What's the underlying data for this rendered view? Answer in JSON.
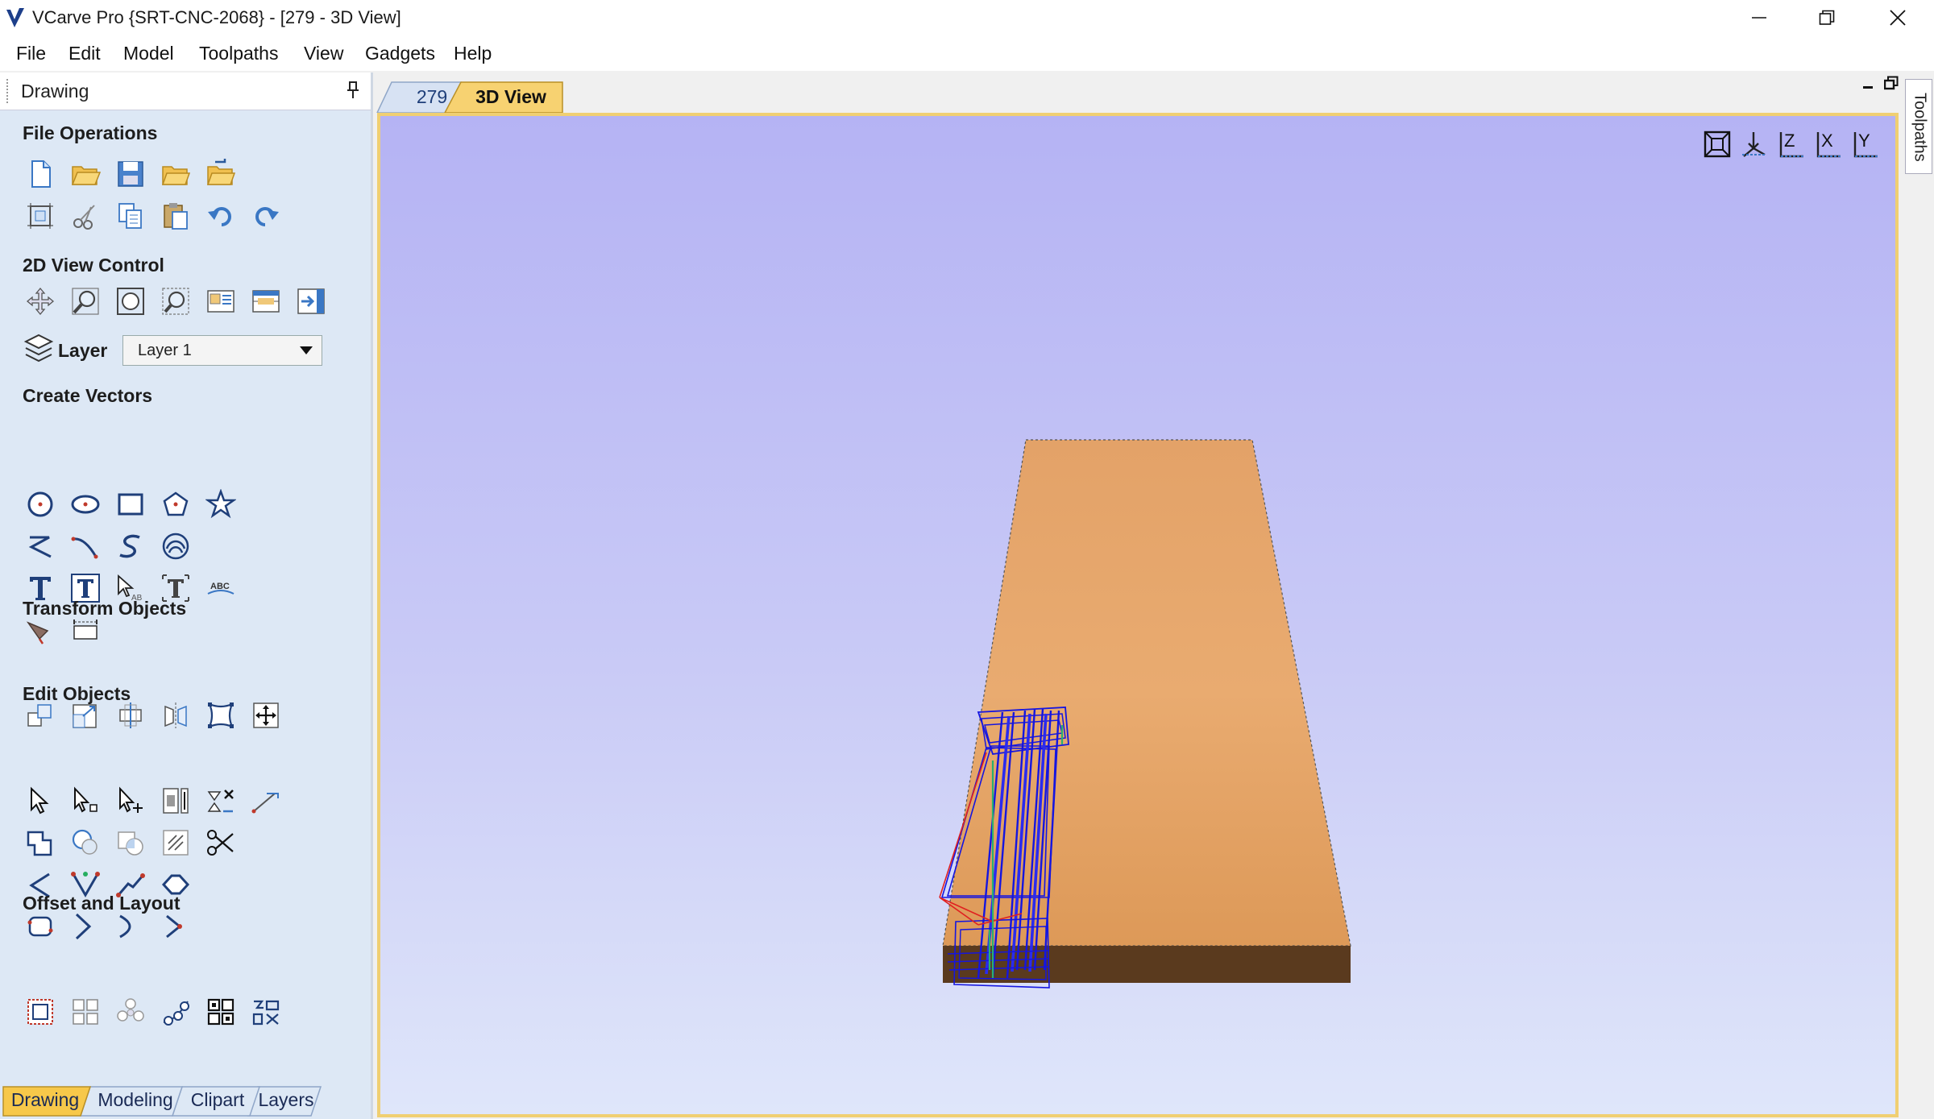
{
  "window": {
    "title": "VCarve Pro {SRT-CNC-2068} - [279 - 3D View]",
    "icons": {
      "minimize": "minimize-icon",
      "restore": "restore-icon",
      "close": "close-icon"
    }
  },
  "menu": {
    "items": [
      "File",
      "Edit",
      "Model",
      "Toolpaths",
      "View",
      "Gadgets",
      "Help"
    ]
  },
  "panel": {
    "title": "Drawing",
    "sections": {
      "file_operations": "File Operations",
      "view_control": "2D View Control",
      "create_vectors": "Create Vectors",
      "transform_objects": "Transform Objects",
      "edit_objects": "Edit Objects",
      "offset_layout": "Offset and Layout"
    },
    "layer": {
      "label": "Layer",
      "value": "Layer 1"
    },
    "bottom_tabs": [
      "Drawing",
      "Modeling",
      "Clipart",
      "Layers"
    ],
    "active_bottom_tab": "Drawing"
  },
  "doc_tabs": [
    "279",
    "3D View"
  ],
  "active_doc_tab": "3D View",
  "right_tab": "Toolpaths",
  "view_axes": [
    "Z",
    "X",
    "Y"
  ],
  "colors": {
    "panel_bg": "#dde8f5",
    "active_tab": "#f7c84a",
    "view_border": "#f0cf72",
    "wood": "#e09a58",
    "toolpath": "#1515e0",
    "rapid_move": "#e02020"
  }
}
